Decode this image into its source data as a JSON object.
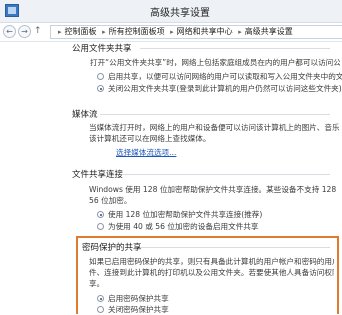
{
  "window": {
    "title": "高级共享设置"
  },
  "addressbar": {
    "crumbs": [
      "控制面板",
      "所有控制面板项",
      "网络和共享中心",
      "高级共享设置"
    ]
  },
  "public_folder": {
    "title": "公用文件夹共享",
    "description": "打开“公用文件夹共享”时，网络上包括家庭组成员在内的用户都可以访问公用文件夹中的",
    "options": [
      "启用共享，以便可以访问网络的用户可以读取和写入公用文件夹中的文件",
      "关闭公用文件夹共享(登录到此计算机的用户仍然可以访问这些文件夹)"
    ],
    "selected_index": 1
  },
  "media_streaming": {
    "title": "媒体流",
    "description_lines": [
      "当媒体流打开时，网络上的用户和设备便可以访问该计算机上的图片、音乐以",
      "该计算机还可以在网络上查找媒体。"
    ],
    "link": "选择媒体流选项..."
  },
  "file_sharing": {
    "title": "文件共享连接",
    "description_lines": [
      "Windows 使用 128 位加密帮助保护文件共享连接。某些设备不支持 128 位加密",
      "56 位加密。"
    ],
    "options": [
      "使用 128 位加密帮助保护文件共享连接(推荐)",
      "为使用 40 或 56 位加密的设备启用文件共享"
    ],
    "selected_index": 0
  },
  "password_protected": {
    "title": "密码保护的共享",
    "description_lines": [
      "如果已启用密码保护的共享，则只有具备此计算机的用户帐户和密码的用户才",
      "件、连接到此计算机的打印机以及公用文件夹。若要使其他人具备访问权限，必须",
      "享。"
    ],
    "options": [
      "启用密码保护共享",
      "关闭密码保护共享"
    ],
    "selected_index": 0
  },
  "colors": {
    "highlight_border": "#e07a2c",
    "link": "#1c57b8"
  }
}
